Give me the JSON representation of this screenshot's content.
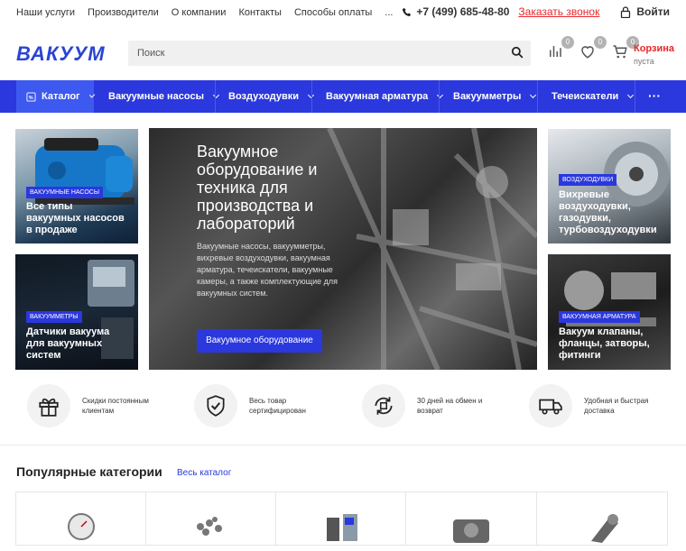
{
  "topbar": {
    "links": [
      "Наши услуги",
      "Производители",
      "О компании",
      "Контакты",
      "Способы оплаты",
      "..."
    ],
    "phone": "+7 (499) 685-48-80",
    "callback": "Заказать звонок",
    "login": "Войти"
  },
  "header": {
    "logo": "ВАКУУМ",
    "search_placeholder": "Поиск",
    "compare_count": "0",
    "favorites_count": "0",
    "cart_count": "0",
    "cart_title": "Корзина",
    "cart_status": "пуста"
  },
  "nav": {
    "catalog": "Каталог",
    "items": [
      "Вакуумные насосы",
      "Воздуходувки",
      "Вакуумная арматура",
      "Вакуумметры",
      "Течеискатели"
    ],
    "more": "···"
  },
  "banners": {
    "left_top": {
      "tag": "ВАКУУМНЫЕ НАСОСЫ",
      "title": "Все типы вакуумных насосов в продаже"
    },
    "left_bottom": {
      "tag": "ВАКУУММЕТРЫ",
      "title": "Датчики вакуума для вакуумных систем"
    },
    "hero": {
      "title": "Вакуумное оборудование и техника для производства и лабораторий",
      "text": "Вакуумные насосы, вакуумметры, вихревые воздуходувки, вакуумная арматура, течеискатели, вакуумные камеры, а также комплектующие для вакуумных систем.",
      "button": "Вакуумное оборудование"
    },
    "right_top": {
      "tag": "ВОЗДУХОДУВКИ",
      "title": "Вихревые воздуходувки, газодувки, турбовоздуходувки"
    },
    "right_bottom": {
      "tag": "ВАКУУМНАЯ АРМАТУРА",
      "title": "Вакуум клапаны, фланцы, затворы, фитинги"
    }
  },
  "advantages": [
    {
      "icon": "gift-icon",
      "text": "Скидки постоянным клиентам"
    },
    {
      "icon": "shield-check-icon",
      "text": "Весь товар сертифицирован"
    },
    {
      "icon": "exchange-icon",
      "text": "30 дней на обмен и возврат"
    },
    {
      "icon": "truck-icon",
      "text": "Удобная и быстрая доставка"
    }
  ],
  "popular": {
    "title": "Популярные категории",
    "all_link": "Весь каталог"
  },
  "colors": {
    "accent": "#2b38dd",
    "red": "#e8262b"
  }
}
